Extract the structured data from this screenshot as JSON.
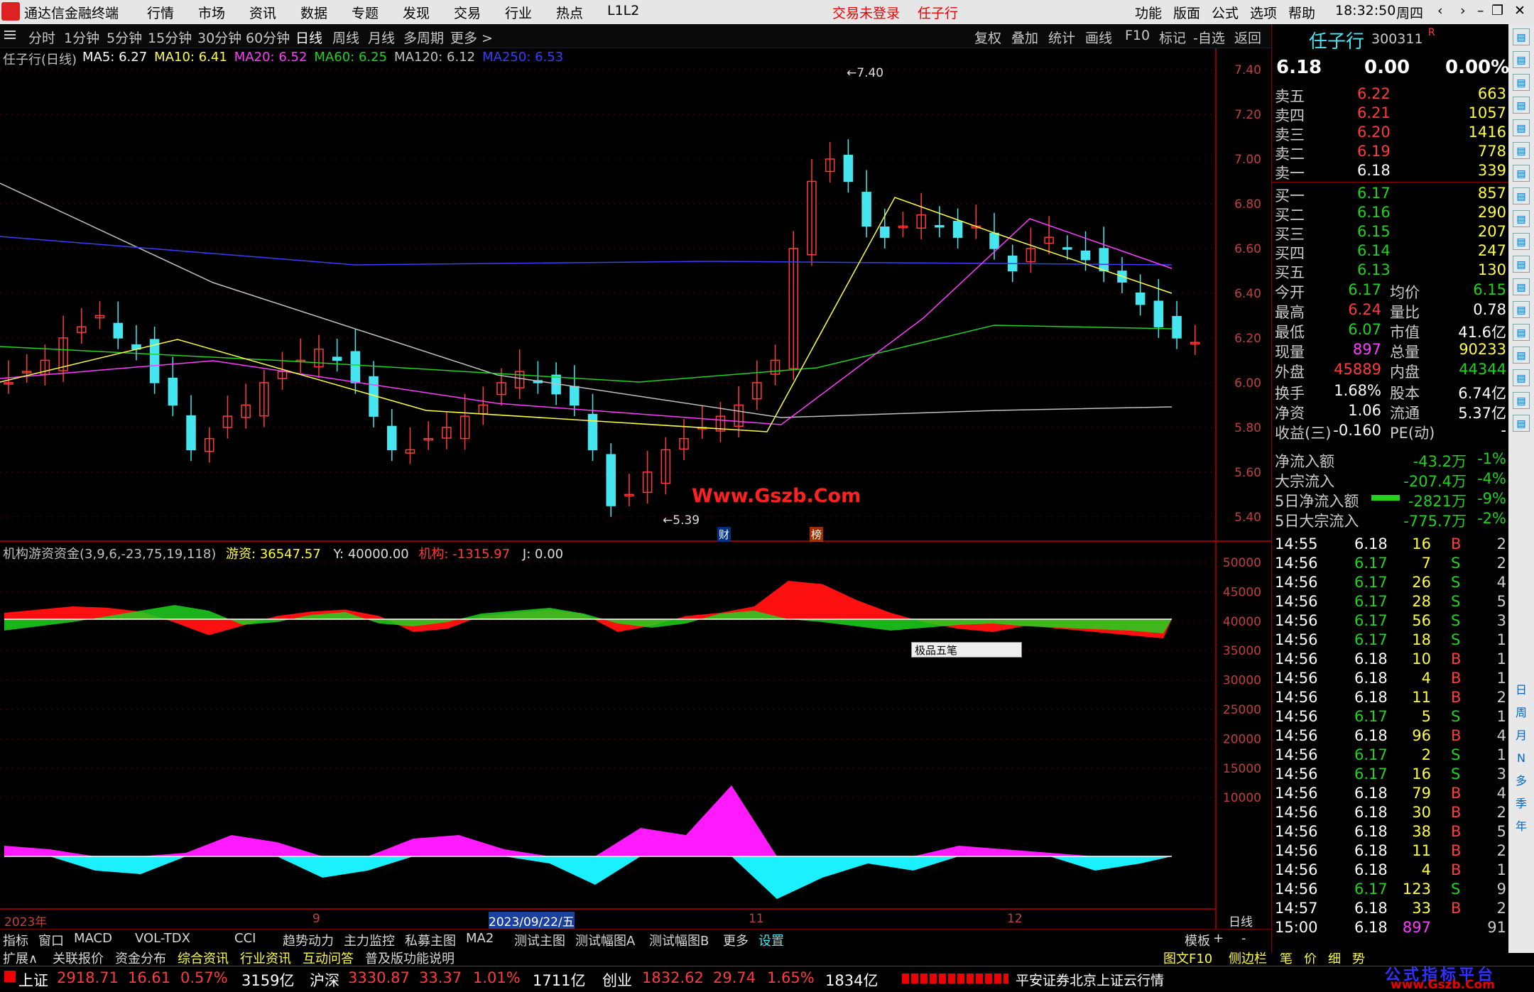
{
  "menubar": {
    "app_title": "通达信金融终端",
    "items": [
      "行情",
      "市场",
      "资讯",
      "数据",
      "专题",
      "发现",
      "交易",
      "行业",
      "热点",
      "L1L2"
    ],
    "status_login": "交易未登录",
    "stock_name_top": "任子行",
    "right_items": [
      "功能",
      "版面",
      "公式",
      "选项",
      "帮助"
    ],
    "time": "18:32:50",
    "weekday": "周四"
  },
  "toolbar": {
    "periods": [
      "分时",
      "1分钟",
      "5分钟",
      "15分钟",
      "30分钟",
      "60分钟",
      "日线",
      "周线",
      "月线",
      "多周期",
      "更多 >"
    ],
    "active": "日线",
    "right_buttons": [
      "复权",
      "叠加",
      "统计",
      "画线",
      "F10",
      "标记",
      "-自选",
      "返回"
    ]
  },
  "main_chart": {
    "title": "任子行(日线)",
    "ma": [
      {
        "label": "MA5: 6.27",
        "color": "#ffffff"
      },
      {
        "label": "MA10: 6.41",
        "color": "#ffff3c"
      },
      {
        "label": "MA20: 6.52",
        "color": "#ff3cff"
      },
      {
        "label": "MA60: 6.25",
        "color": "#1fd31f"
      },
      {
        "label": "MA120: 6.12",
        "color": "#c0c0c0"
      },
      {
        "label": "MA250: 6.53",
        "color": "#3c3cff"
      }
    ],
    "y_ticks": [
      "7.40",
      "7.20",
      "7.00",
      "6.80",
      "6.60",
      "6.40",
      "6.20",
      "6.00",
      "5.80",
      "5.60",
      "5.40"
    ],
    "high_label": "7.40",
    "low_label": "5.39",
    "watermark": "Www.Gszb.Com",
    "marker_cai": "财",
    "marker_bang": "榜"
  },
  "indicator": {
    "title": "机构游资资金(3,9,6,-23,75,19,118)",
    "youzi_label": "游资: 36547.57",
    "y_label": "Y: 40000.00",
    "jigou_label": "机构: -1315.97",
    "j_label": "J: 0.00",
    "y_ticks": [
      "50000",
      "45000",
      "40000",
      "35000",
      "30000",
      "25000",
      "20000",
      "15000",
      "10000"
    ],
    "ime_label": "极品五笔"
  },
  "xaxis": {
    "labels": [
      "2023年",
      "9",
      "2023/09/22/五",
      "11",
      "12"
    ],
    "period_label": "日线"
  },
  "tabs_row1": [
    "指标",
    "窗口",
    "MACD",
    "VOL-TDX",
    "CCI",
    "趋势动力",
    "主力监控",
    "私募主图",
    "MA2",
    "测试主图",
    "测试幅图A",
    "测试幅图B",
    "更多",
    "设置"
  ],
  "tabs_row1_right": [
    "模板",
    "+",
    "-"
  ],
  "tabs_row2": [
    "扩展∧",
    "关联报价",
    "资金分布",
    "综合资讯",
    "行业资讯",
    "互动问答",
    "普及版功能说明"
  ],
  "tabs_row2_right": [
    "图文F10",
    "侧边栏《",
    "笔",
    "价",
    "细",
    "势"
  ],
  "quote": {
    "name": "任子行",
    "code": "300311",
    "flag": "R",
    "price": "6.18",
    "change": "0.00",
    "pct": "0.00%",
    "asks": [
      {
        "label": "卖五",
        "price": "6.22",
        "vol": "663"
      },
      {
        "label": "卖四",
        "price": "6.21",
        "vol": "1057"
      },
      {
        "label": "卖三",
        "price": "6.20",
        "vol": "1416"
      },
      {
        "label": "卖二",
        "price": "6.19",
        "vol": "778"
      },
      {
        "label": "卖一",
        "price": "6.18",
        "vol": "339"
      }
    ],
    "bids": [
      {
        "label": "买一",
        "price": "6.17",
        "vol": "857"
      },
      {
        "label": "买二",
        "price": "6.16",
        "vol": "290"
      },
      {
        "label": "买三",
        "price": "6.15",
        "vol": "207"
      },
      {
        "label": "买四",
        "price": "6.14",
        "vol": "247"
      },
      {
        "label": "买五",
        "price": "6.13",
        "vol": "130"
      }
    ],
    "stats": [
      [
        "今开",
        "6.17",
        "均价",
        "6.15"
      ],
      [
        "最高",
        "6.24",
        "量比",
        "0.78"
      ],
      [
        "最低",
        "6.07",
        "市值",
        "41.6亿"
      ],
      [
        "现量",
        "897",
        "总量",
        "90233"
      ],
      [
        "外盘",
        "45889",
        "内盘",
        "44344"
      ]
    ],
    "stats2": [
      [
        "换手",
        "1.68%",
        "股本",
        "6.74亿"
      ],
      [
        "净资",
        "1.06",
        "流通",
        "5.37亿"
      ],
      [
        "收益(三)",
        "-0.160",
        "PE(动)",
        "-"
      ]
    ],
    "flows": [
      [
        "净流入额",
        "-43.2万",
        "-1%"
      ],
      [
        "大宗流入",
        "-207.4万",
        "-4%"
      ],
      [
        "5日净流入额",
        "-2821万",
        "-9%"
      ],
      [
        "5日大宗流入",
        "-775.7万",
        "-2%"
      ]
    ],
    "ticks": [
      [
        "14:55",
        "6.18",
        "16",
        "B",
        "2"
      ],
      [
        "14:56",
        "6.17",
        "7",
        "S",
        "2"
      ],
      [
        "14:56",
        "6.17",
        "26",
        "S",
        "4"
      ],
      [
        "14:56",
        "6.17",
        "28",
        "S",
        "5"
      ],
      [
        "14:56",
        "6.17",
        "56",
        "S",
        "3"
      ],
      [
        "14:56",
        "6.17",
        "18",
        "S",
        "1"
      ],
      [
        "14:56",
        "6.18",
        "10",
        "B",
        "1"
      ],
      [
        "14:56",
        "6.18",
        "4",
        "B",
        "1"
      ],
      [
        "14:56",
        "6.18",
        "11",
        "B",
        "2"
      ],
      [
        "14:56",
        "6.17",
        "5",
        "S",
        "1"
      ],
      [
        "14:56",
        "6.18",
        "96",
        "B",
        "4"
      ],
      [
        "14:56",
        "6.17",
        "2",
        "S",
        "1"
      ],
      [
        "14:56",
        "6.17",
        "16",
        "S",
        "3"
      ],
      [
        "14:56",
        "6.18",
        "79",
        "B",
        "4"
      ],
      [
        "14:56",
        "6.18",
        "30",
        "B",
        "2"
      ],
      [
        "14:56",
        "6.18",
        "38",
        "B",
        "5"
      ],
      [
        "14:56",
        "6.18",
        "11",
        "B",
        "2"
      ],
      [
        "14:56",
        "6.18",
        "4",
        "B",
        "1"
      ],
      [
        "14:56",
        "6.17",
        "123",
        "S",
        "9"
      ],
      [
        "14:57",
        "6.18",
        "33",
        "B",
        "2"
      ],
      [
        "15:00",
        "6.18",
        "897",
        "",
        "91"
      ]
    ]
  },
  "sidebar": [
    "日",
    "周",
    "月",
    "N",
    "多",
    "季",
    "年"
  ],
  "status": {
    "sh_label": "上证",
    "sh_val": "2918.71",
    "sh_chg": "16.61",
    "sh_pct": "0.57%",
    "sh_amt": "3159亿",
    "hs_label": "沪深",
    "hs_val": "3330.87",
    "hs_chg": "33.37",
    "hs_pct": "1.01%",
    "hs_amt": "1711亿",
    "cy_label": "创业",
    "cy_val": "1832.62",
    "cy_chg": "29.74",
    "cy_pct": "1.65%",
    "cy_amt": "1834亿",
    "server": "平安证券北京上证云行情",
    "brand_cn": "公式指标平台",
    "brand_url": "www.Gszb.Com"
  },
  "chart_data": {
    "type": "candlestick",
    "series_indicator": "机构游资资金",
    "ylim": [
      5.39,
      7.4
    ],
    "high": 7.4,
    "low": 5.39,
    "last_close": 6.18
  }
}
